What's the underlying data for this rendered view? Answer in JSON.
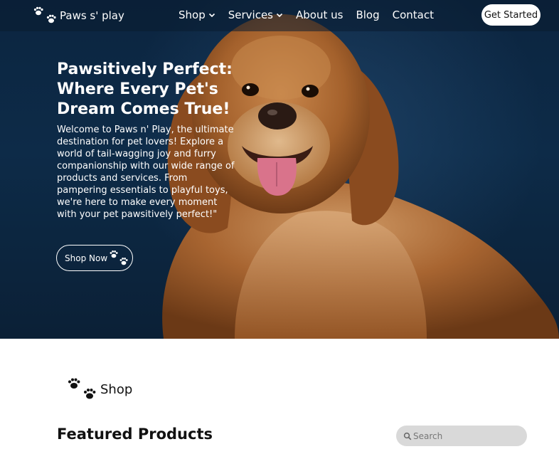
{
  "brand": {
    "name": "Paws s' play",
    "icon": "paw-prints-icon"
  },
  "nav": {
    "items": [
      {
        "label": "Shop",
        "has_dropdown": true
      },
      {
        "label": "Services",
        "has_dropdown": true
      },
      {
        "label": "About us",
        "has_dropdown": false
      },
      {
        "label": "Blog",
        "has_dropdown": false
      },
      {
        "label": "Contact",
        "has_dropdown": false
      }
    ],
    "cta_label": "Get Started"
  },
  "hero": {
    "title": "Pawsitively Perfect: Where Every Pet's Dream Comes True!",
    "description": "Welcome to Paws n' Play, the ultimate destination for pet lovers! Explore a world of tail-wagging joy and furry companionship with our wide range of products and services. From pampering essentials to playful toys, we're here to make every moment with your pet pawsitively perfect!\"",
    "button_label": "Shop Now"
  },
  "shop_section": {
    "label": "Shop",
    "heading": "Featured Products",
    "search_placeholder": "Search"
  },
  "colors": {
    "hero_bg": "#0d2b48",
    "accent": "#ffffff",
    "search_bg": "#d9d9d9"
  }
}
